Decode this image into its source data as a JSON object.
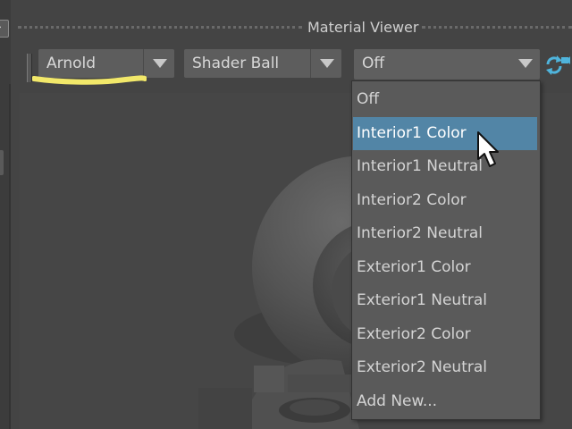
{
  "panel": {
    "title": "Material Viewer"
  },
  "toolbar": {
    "renderer": {
      "value": "Arnold"
    },
    "geometry": {
      "value": "Shader Ball"
    },
    "environment": {
      "value": "Off"
    }
  },
  "environment_menu": {
    "selected_index": 1,
    "items": [
      "Off",
      "Interior1 Color",
      "Interior1 Neutral",
      "Interior2 Color",
      "Interior2 Neutral",
      "Exterior1 Color",
      "Exterior1 Neutral",
      "Exterior2 Color",
      "Exterior2 Neutral",
      "Add New..."
    ]
  },
  "icons": {
    "dropdown_arrow": "triangle-down-icon",
    "swap": "swap-camera-icon",
    "cursor": "arrow-cursor-icon"
  },
  "colors": {
    "menu_selected": "#5285a6",
    "highlight_stroke": "#f2e86a",
    "swap_icon": "#4fb4dc"
  }
}
